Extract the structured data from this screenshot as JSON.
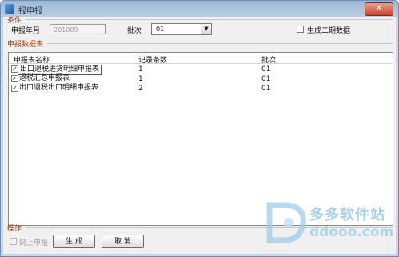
{
  "window": {
    "title": "报申报",
    "close_glyph": "✕"
  },
  "conditions": {
    "section_label": "条件",
    "year_month_label": "申报年月",
    "year_month_value": "201009",
    "batch_label": "批次",
    "batch_value": "01",
    "second_period_label": "生成二期数据",
    "second_period_checked": false
  },
  "table": {
    "section_label": "申报数据表",
    "headers": [
      "申报表名称",
      "记录条数",
      "批次"
    ],
    "rows": [
      {
        "checked": true,
        "name": "出口退税进货明细申报表",
        "count": "1",
        "batch": "01"
      },
      {
        "checked": true,
        "name": "退税汇总申报表",
        "count": "1",
        "batch": "01"
      },
      {
        "checked": true,
        "name": "出口退税出口明细申报表",
        "count": "2",
        "batch": "01"
      }
    ]
  },
  "operations": {
    "section_label": "操作",
    "online_label": "网上申报",
    "online_checked": false,
    "generate_label": "生 成",
    "cancel_label": "取 消"
  },
  "watermark": {
    "brand": "多多软件站",
    "url": "ddooo.com",
    "logo_letter": "D"
  },
  "colors": {
    "section_label": "#9a3c10",
    "title_bar": "#b9cde4"
  },
  "icons": {
    "check": "✓",
    "dropdown": "▼"
  }
}
